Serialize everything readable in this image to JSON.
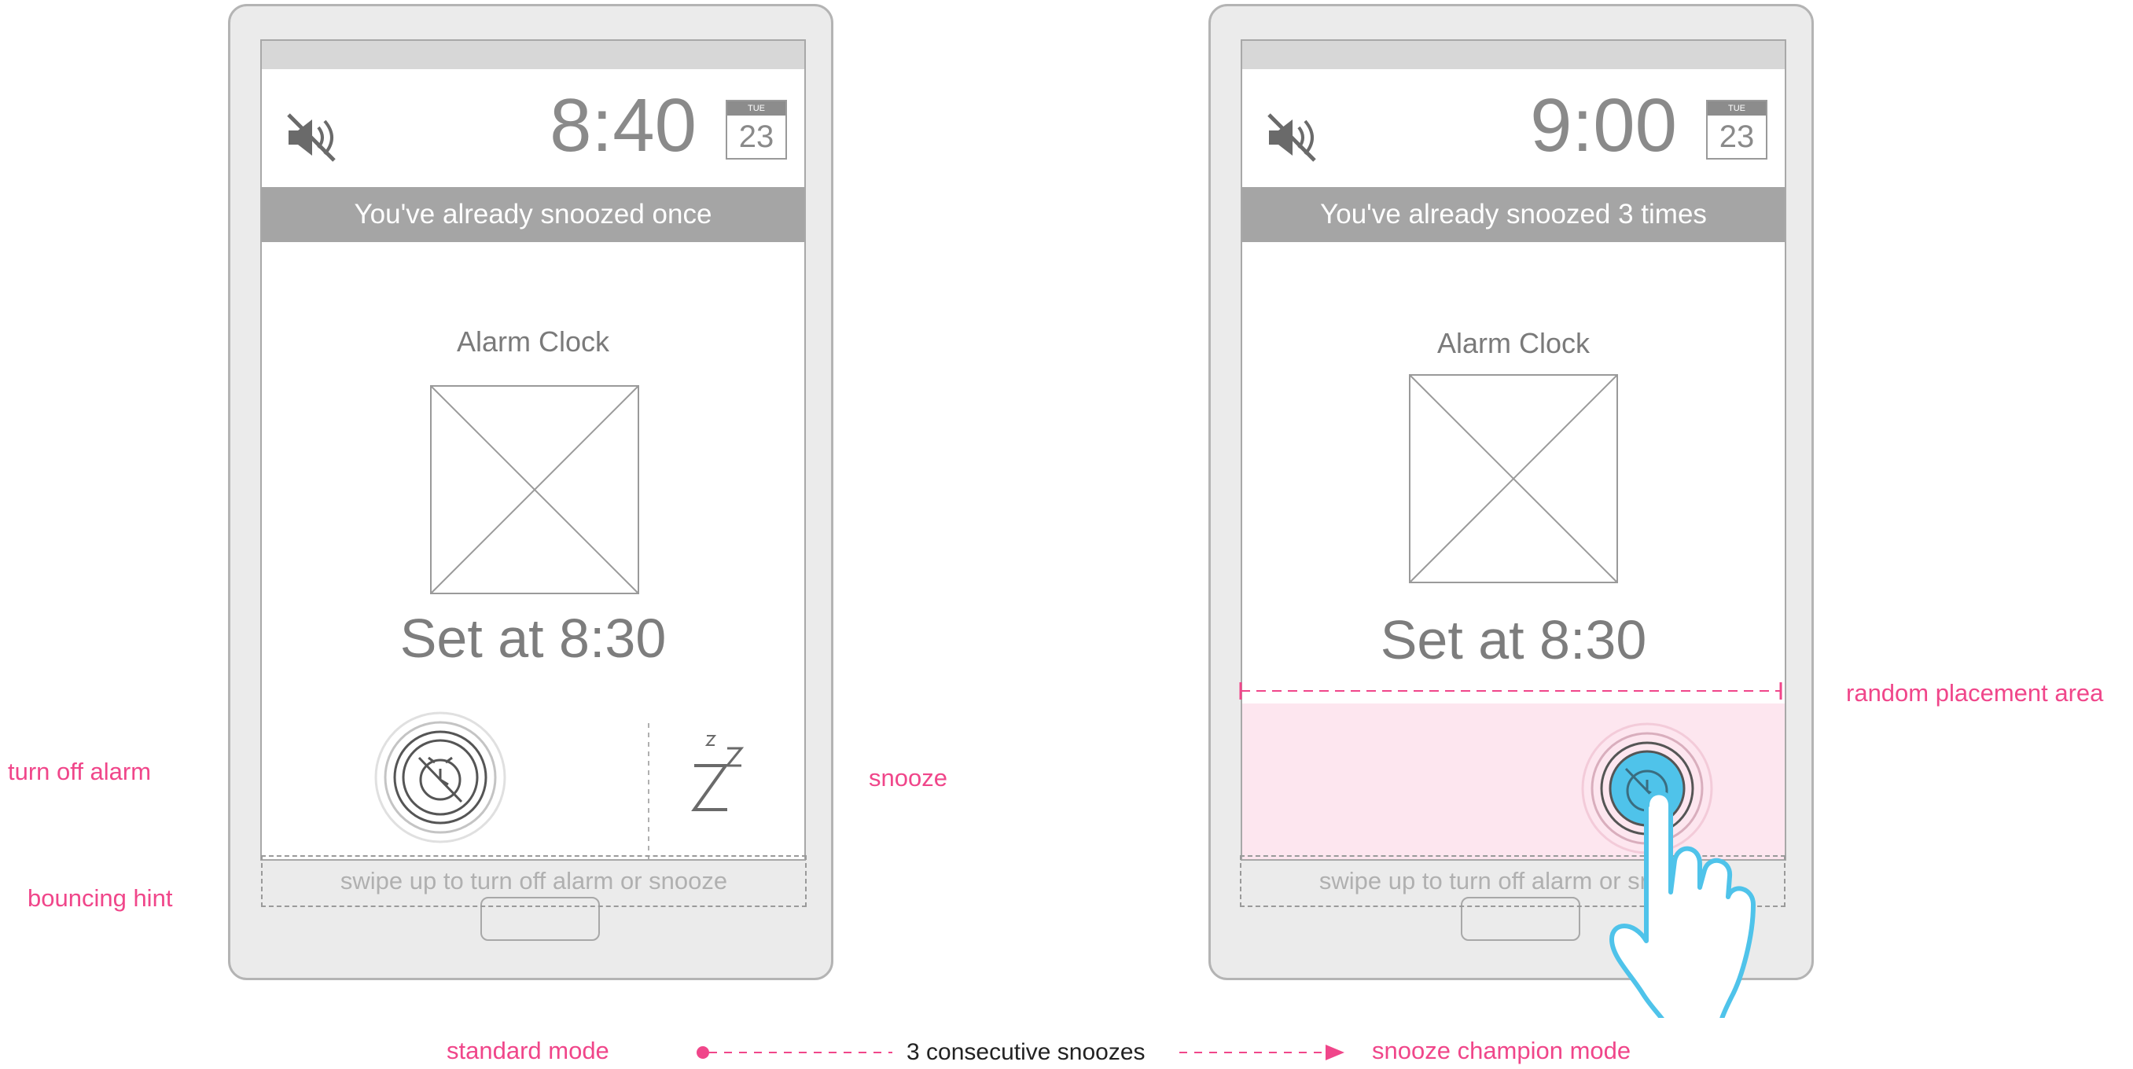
{
  "left_screen": {
    "clock": "8:40",
    "calendar_day_name": "TUE",
    "calendar_day": "23",
    "banner": "You've already snoozed once",
    "app_title": "Alarm Clock",
    "set_at": "Set at 8:30",
    "hint": "swipe up to turn off alarm or snooze"
  },
  "right_screen": {
    "clock": "9:00",
    "calendar_day_name": "TUE",
    "calendar_day": "23",
    "banner": "You've already snoozed 3 times",
    "app_title": "Alarm Clock",
    "set_at": "Set at 8:30",
    "hint": "swipe up to turn off alarm or snooze"
  },
  "annotations": {
    "turn_off_alarm": "turn off alarm",
    "bouncing_hint": "bouncing hint",
    "snooze": "snooze",
    "random_placement_area": "random placement area",
    "standard_mode": "standard mode",
    "transition": "3 consecutive snoozes",
    "champion_mode": "snooze champion mode"
  },
  "icons": {
    "mute": "speaker-muted-icon",
    "alarm_off": "alarm-off-icon",
    "snooze": "zzz-icon",
    "hand": "pointing-hand-icon"
  },
  "colors": {
    "annotation_pink": "#f0468a",
    "tap_blue": "#4fc3ea",
    "random_area_fill": "#fde6ef"
  }
}
